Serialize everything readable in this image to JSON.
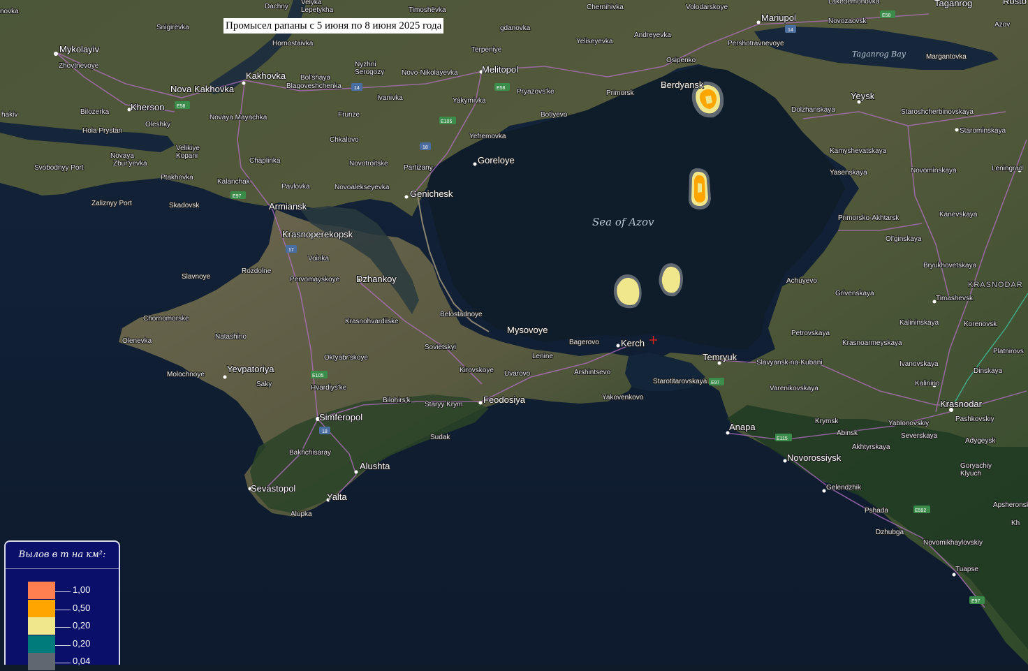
{
  "title": "Промысел рапаны с 5 июня по 8 июня 2025 года",
  "legend": {
    "title": "Вылов в т на км²:",
    "items": [
      {
        "value": "1,00",
        "color": "#ff7f50"
      },
      {
        "value": "0,50",
        "color": "#ffa500"
      },
      {
        "value": "0,20",
        "color": "#f0e68c"
      },
      {
        "value": "0,20",
        "color": "#007b7b"
      },
      {
        "value": "0,04",
        "color": "#5f6770"
      }
    ]
  },
  "water": {
    "sea": "Sea of Azov",
    "bay": "Taganrog Bay"
  },
  "places": {
    "novka": "novka",
    "snigirevka": "Snigirëvka",
    "mykolaiv": "Mykolayiv",
    "zhovtnevoye": "Zhovtnevoye",
    "dachny": "Dachny",
    "velyka": "Velyka",
    "lepetykha": "Lepetykha",
    "timoshevka": "Timoshëvka",
    "chernihivka": "Chernihivka",
    "volodarskoye": "Volodarskoye",
    "mariupol": "Mariupol",
    "lakedemonovka": "Lakedemonovka",
    "taganrog": "Taganrog",
    "rosto": "Rosto",
    "novozaovsk": "Novozaovsk",
    "azov": "Azov",
    "gdanovka": "gdanovka",
    "hornostaivka": "Hornostaivka",
    "nyzhni": "Nyzhni",
    "serohozy": "Serogozy",
    "andreyevka": "Andreyevka",
    "yelseyevka": "Yeliseyevka",
    "pershotravnevoye": "Pershotravnevoye",
    "margantovka": "Margantovka",
    "terpeniye": "Terpeniye",
    "osipenko": "Osipenko",
    "kakhovka": "Kakhovka",
    "bolshaya": "Bol'shaya",
    "blagoveshchenka": "Blagoveshchenka",
    "novo_nikolayevka": "Novo-Nikolayevka",
    "melitopol": "Melitopol",
    "nova_kakhovka": "Nova Kakhovka",
    "ivanivka": "Ivanivka",
    "pryazovske": "Pryazovs'ke",
    "primorsk": "Primorsk",
    "berdyansk": "Berdyansk",
    "yeysk": "Yeysk",
    "khakiv": "hakiv",
    "bilozerka": "Bilozerka",
    "kherson": "Kherson",
    "novaya_mayachka": "Novaya Mayachka",
    "yakymivka": "Yakymivka",
    "botiyevo": "Botiyevo",
    "dolzhanskaya": "Dolzhanskaya",
    "starosherbinovskaya": "Staroshcherbinovskaya",
    "starominskaya": "Starominskaya",
    "oleshky": "Oleshky",
    "frunze": "Frunze",
    "hola_prystan": "Hola Prystan",
    "yefremovka": "Yefremovka",
    "chkalovo": "Chkalovo",
    "velikiye_kopani": "Velikiye\nKopani",
    "novaya": "Novaya",
    "zburyevka": "Zbur'yevka",
    "chaplinka": "Chaplinka",
    "novotroitske": "Novotroitske",
    "partizany": "Partizany",
    "goreloye": "Goreloye",
    "kamyshevatskaya": "Kamyshevatskaya",
    "yasenskaya": "Yasenskaya",
    "novominskaya": "Novominskaya",
    "leningradskaya": "Leningrad",
    "svobodnyy_port": "Svobodnyy Port",
    "ptakhovka": "Ptakhovka",
    "kalanchak": "Kalanchak",
    "pavlovka": "Pavlovka",
    "novoalekseyevka": "Novoalekseyevka",
    "genichesk": "Genichesk",
    "primorsko_akhtarsk": "Primorsko-Akhtarsk",
    "kanevskaya": "Kanevskaya",
    "zalizny_port": "Zaliznyy Port",
    "skadovsk": "Skadovsk",
    "armiansk": "Armiansk",
    "olginskaya": "Ol'ginskaya",
    "krasnoperekopsk": "Krasnoperekopsk",
    "bryukhovetskaya": "Bryukhovetskaya",
    "voinka": "Voinka",
    "rozdolne": "Rozdolne",
    "slavnoye": "Slavnoye",
    "pervomayskoye": "Pervomayskoye",
    "dzhankoy": "Dzhankoy",
    "achuyevo": "Achuyevo",
    "krasnodar_region": "KRASNODAR",
    "grivenskaya": "Grivenskaya",
    "timashevsk": "Timashevsk",
    "belostadnoye": "Belostadnoye",
    "chornomorske": "Chornomorske",
    "krasnohvardiyske": "Krasnohvardiiske",
    "kalininskaya": "Kalininskaya",
    "korenovsk": "Korenovsk",
    "mysovoye": "Mysovoye",
    "petrovskaya": "Petrovskaya",
    "olenevka": "Olenevka",
    "natashino": "Natashino",
    "bagerovo": "Bagerovo",
    "kerch": "Kerch",
    "krasnoarmeyskaya": "Krasnoarmeyskaya",
    "platnirovskaya": "Platnirovs",
    "sovietskyi": "Sovietskyi",
    "lenine": "Lenine",
    "oktyabrskoye": "Oktyabr'skoye",
    "temryuk": "Temryuk",
    "ivanovskaya": "Ivanovskaya",
    "slavyansk": "Slavyansk-na-Kubani",
    "kirovskoye": "Kirovskoye",
    "uvarovo": "Uvarovo",
    "arshintsevo": "Arshintsevo",
    "dinskaya": "Dinskaya",
    "molochnoye": "Molochnoye",
    "yevpatoriya": "Yevpatoriya",
    "starotitarovskaya": "Starotitarovskaya",
    "varenikovskaya": "Varenikovskaya",
    "kalinino": "Kalinino",
    "saky": "Saky",
    "hvardiyske": "Hvardiys'ke",
    "krasnodar": "Krasnodar",
    "yakovenkovo": "Yakovenkovo",
    "bilohirsk": "Bilohirs'k",
    "staryy_krym": "Staryy Krym",
    "feodosiya": "Feodosiya",
    "pashkovskiy": "Pashkovskiy",
    "krymsk": "Krymsk",
    "yablonovskiy": "Yablonovskiy",
    "simferopol": "Simferopol",
    "anapa": "Anapa",
    "abinsk": "Abinsk",
    "severskaya": "Severskaya",
    "adygeysk": "Adygeysk",
    "sudak": "Sudak",
    "akhtyrskaya": "Akhtyrskaya",
    "novorossiysk": "Novorossiysk",
    "bakhchisaray": "Bakhchisaray",
    "goryachiy_klyuch": "Goryachiy\nKlyuch",
    "alushta": "Alushta",
    "sevastopol": "Sevastopol",
    "gelendzhik": "Gelendzhik",
    "yalta": "Yalta",
    "apsheronsk": "Apsheronsk",
    "pshada": "Pshada",
    "alupka": "Alupka",
    "dzhubga": "Dzhubga",
    "kha": "Kh",
    "novomikhaylovskiy": "Novomikhaylovskiy",
    "tuapse": "Tuapse"
  },
  "roads": {
    "e58": "E58",
    "r14a": "14",
    "r14b": "14",
    "e58b": "E58",
    "e105": "E105",
    "r18a": "18",
    "e97": "E97",
    "r17": "17",
    "e105b": "E105",
    "r18b": "18",
    "e97b": "E97",
    "e115": "E115",
    "e592": "E592",
    "e97c": "E97"
  },
  "catch_zones": [
    {
      "id": "zone-berdyansk",
      "level": "0,50"
    },
    {
      "id": "zone-central",
      "level": "0,50"
    },
    {
      "id": "zone-west",
      "level": "0,20"
    },
    {
      "id": "zone-east",
      "level": "0,20"
    }
  ],
  "colors": {
    "sea": "#0f1e2c",
    "sea_deep": "#0d1d33",
    "land": "#3e4a2e",
    "land_light": "#6a6a4a",
    "road": "#b070c0",
    "marker": "#e02020"
  }
}
